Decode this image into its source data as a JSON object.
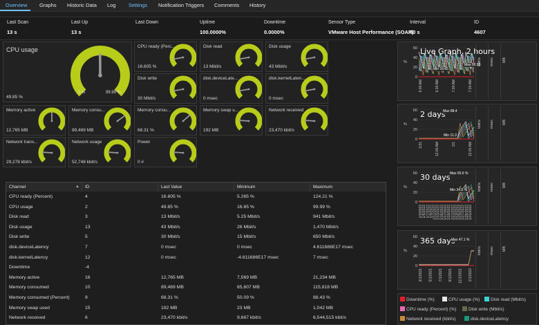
{
  "tabs": [
    "Overview",
    "Graphs",
    "Historic Data",
    "Log",
    "Settings",
    "Notification Triggers",
    "Comments",
    "History"
  ],
  "info": [
    {
      "label": "Last Scan",
      "value": "13 s"
    },
    {
      "label": "Last Up",
      "value": "13 s"
    },
    {
      "label": "Last Down",
      "value": ""
    },
    {
      "label": "Uptime",
      "value": "100.0000%"
    },
    {
      "label": "Downtime",
      "value": "0.0000%"
    },
    {
      "label": "Sensor Type",
      "value": "VMware Host Performance (SOAP)"
    },
    {
      "label": "Interval",
      "value": "60 s"
    },
    {
      "label": "ID",
      "value": "4607"
    }
  ],
  "cpu_gauge": {
    "title": "CPU usage",
    "value": "49.85 %",
    "min": "0 %",
    "max": "99.99 %",
    "level": 0.4985
  },
  "gauges": [
    {
      "title": "CPU ready (Perc...",
      "value": "16.605 %",
      "level": 0.13
    },
    {
      "title": "Disk read",
      "value": "13 Mbit/s",
      "level": 0.13
    },
    {
      "title": "Disk usage",
      "value": "43 Mbit/s",
      "level": 0.13
    },
    {
      "title": "Disk write",
      "value": "30 Mbit/s",
      "level": 0.13
    },
    {
      "title": "disk.deviceLate...",
      "value": "0 msec",
      "level": 0.13
    },
    {
      "title": "disk.kernelLaten...",
      "value": "0 msec",
      "level": 0.13
    },
    {
      "title": "Memory active",
      "value": "12,765 MB",
      "level": 0.5
    },
    {
      "title": "Memory consu...",
      "value": "89,469 MB",
      "level": 0.7
    },
    {
      "title": "Memory consu...",
      "value": "68.31 %",
      "level": 0.68
    },
    {
      "title": "Memory swap u...",
      "value": "192 MB",
      "level": 0.18
    },
    {
      "title": "Network received",
      "value": "23,470 kbit/s",
      "level": 0.18
    },
    {
      "title": "Network trans...",
      "value": "29,278 kbit/s",
      "level": 0.18
    },
    {
      "title": "Network usage",
      "value": "52,748 kbit/s",
      "level": 0.18
    },
    {
      "title": "Power",
      "value": "0 #",
      "level": 0.18
    }
  ],
  "table": {
    "headers": [
      "Channel",
      "ID",
      "Last Value",
      "Minimum",
      "Maximum"
    ],
    "rows": [
      [
        "CPU ready (Percent)",
        "4",
        "16.605 %",
        "5.265 %",
        "124.21 %"
      ],
      [
        "CPU usage",
        "2",
        "49.85 %",
        "16.65 %",
        "99.99 %"
      ],
      [
        "Disk read",
        "3",
        "13 Mbit/s",
        "5.25 Mbit/s",
        "941 Mbit/s"
      ],
      [
        "Disk usage",
        "13",
        "43 Mbit/s",
        "26 Mbit/s",
        "1,470 Mbit/s"
      ],
      [
        "Disk write",
        "5",
        "30 Mbit/s",
        "15 Mbit/s",
        "650 Mbit/s"
      ],
      [
        "disk.deviceLatency",
        "7",
        "0 msec",
        "0 msec",
        "4.611686E17 msec"
      ],
      [
        "disk.kernelLatency",
        "12",
        "0 msec",
        "-4.611686E17 msec",
        "7 msec"
      ],
      [
        "Downtime",
        "-4",
        "",
        "",
        ""
      ],
      [
        "Memory active",
        "16",
        "12,765 MB",
        "7,569 MB",
        "21,234 MB"
      ],
      [
        "Memory consumed",
        "10",
        "89,469 MB",
        "65,607 MB",
        "115,818 MB"
      ],
      [
        "Memory consumed (Percent)",
        "9",
        "68.31 %",
        "50.09 %",
        "88.43 %"
      ],
      [
        "Memory swap used",
        "15",
        "192 MB",
        "23 MB",
        "1,042 MB"
      ],
      [
        "Network received",
        "6",
        "23,470 kbit/s",
        "9,667 kbit/s",
        "6,544,515 kbit/s"
      ]
    ]
  },
  "graphs": [
    {
      "title": "Live Graph, 2 hours",
      "yticks": [
        "60",
        "40",
        "20",
        "0"
      ],
      "xticks": [
        "6:00 AM",
        "6:30 AM",
        "7:00 AM",
        "7:30 AM"
      ],
      "max": "Max 99.99",
      "min": "Min 16.65"
    },
    {
      "title": "2 days",
      "yticks": [
        "60",
        "40",
        "20",
        "0"
      ],
      "xticks": [
        "1/31",
        "12:00 AM",
        "2/1",
        "12:00 AM"
      ],
      "max": "Max 88.4",
      "min": "Min 11.3"
    },
    {
      "title": "30 days",
      "yticks": [
        "60",
        "40",
        "20",
        "0"
      ],
      "xticks": [
        "1/3/2022",
        "1/5/2022",
        "1/7/2022",
        "1/9/2022",
        "1/11/2022",
        "1/13/2022",
        "1/15/2022",
        "1/17/2022",
        "1/19/2022",
        "1/21/2022",
        "1/23/2022",
        "1/25/2022",
        "1/27/2022",
        "1/29/2022",
        "1/31/2022"
      ],
      "max": "Max 65.6 %",
      "min": "Min 34.5 %"
    },
    {
      "title": "365 days",
      "yticks": [
        "60",
        "40",
        "20",
        "0"
      ],
      "xticks": [
        "3/1/2021",
        "5/1/2021",
        "7/1/2021",
        "9/1/2021",
        "11/1/2021",
        "1/1/2022"
      ],
      "max": "Max 47.1 %",
      "min": ""
    }
  ],
  "graph_axes": [
    "%",
    "kbit/s",
    "msec",
    "MB"
  ],
  "legend": [
    {
      "label": "Downtime  (%)",
      "color": "#e0202a"
    },
    {
      "label": "CPU usage  (%)",
      "color": "#e8e8e8"
    },
    {
      "label": "Disk read  (Mbit/s)",
      "color": "#40d0d0"
    },
    {
      "label": "CPU ready (Percent)  (%)",
      "color": "#e868b0"
    },
    {
      "label": "Disk write  (Mbit/s)",
      "color": "#6a6a4a"
    },
    {
      "label": "Network received  (kbit/s)",
      "color": "#c88a40"
    },
    {
      "label": "disk.deviceLatency",
      "color": "#1a9a7a"
    }
  ],
  "colors": {
    "gauge": "#b8cc1a",
    "gauge_track": "#3c3c3c",
    "accent": "#6fc0ff"
  }
}
